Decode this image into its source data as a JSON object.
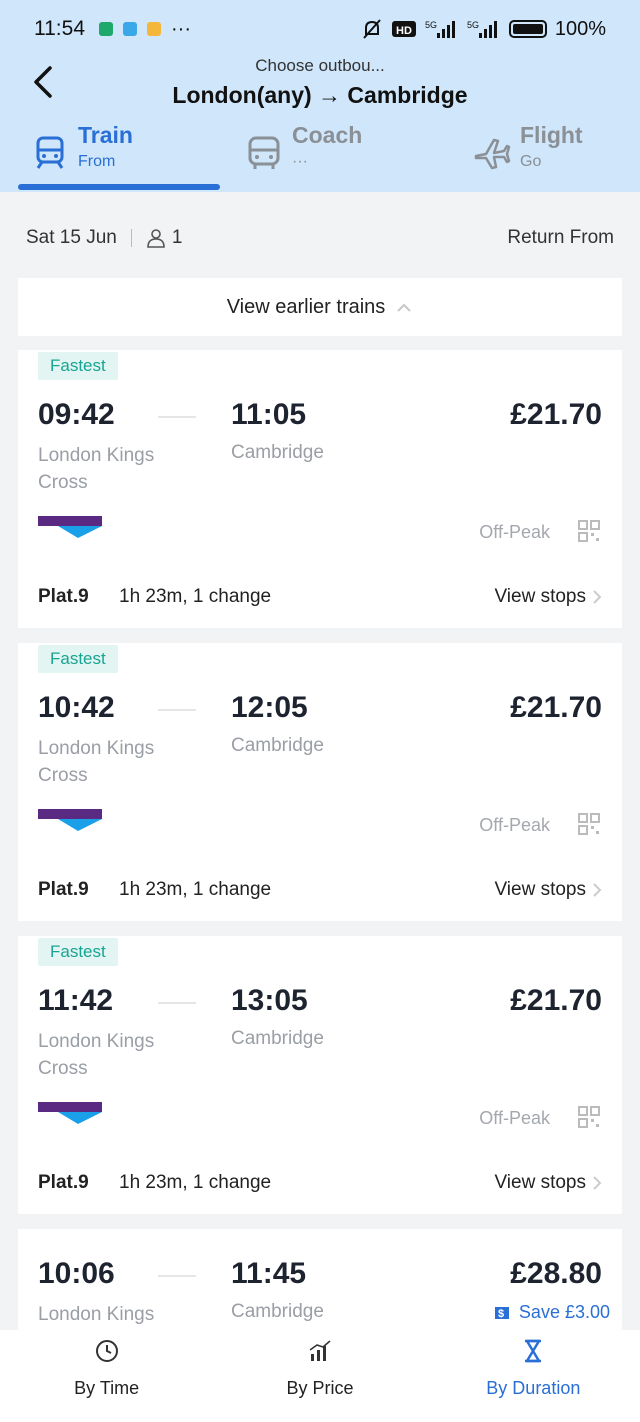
{
  "status": {
    "time": "11:54",
    "battery": "100%",
    "dots": "···"
  },
  "header": {
    "subtitle": "Choose outbou...",
    "route": "London(any) → Cambridge"
  },
  "tabs": [
    {
      "label": "Train",
      "sub": "From",
      "active": true
    },
    {
      "label": "Coach",
      "sub": "···"
    },
    {
      "label": "Flight",
      "sub": "Go"
    }
  ],
  "datebar": {
    "date": "Sat 15 Jun",
    "passengers": "1",
    "return_label": "Return From"
  },
  "earlier": {
    "label": "View earlier trains"
  },
  "journeys": [
    {
      "badge": "Fastest",
      "dep": "09:42",
      "arr": "11:05",
      "price": "£21.70",
      "from": "London Kings Cross",
      "to": "Cambridge",
      "fare": "Off-Peak",
      "plat": "Plat.9",
      "duration": "1h 23m, 1 change",
      "stops": "View stops"
    },
    {
      "badge": "Fastest",
      "dep": "10:42",
      "arr": "12:05",
      "price": "£21.70",
      "from": "London Kings Cross",
      "to": "Cambridge",
      "fare": "Off-Peak",
      "plat": "Plat.9",
      "duration": "1h 23m, 1 change",
      "stops": "View stops"
    },
    {
      "badge": "Fastest",
      "dep": "11:42",
      "arr": "13:05",
      "price": "£21.70",
      "from": "London Kings Cross",
      "to": "Cambridge",
      "fare": "Off-Peak",
      "plat": "Plat.9",
      "duration": "1h 23m, 1 change",
      "stops": "View stops"
    },
    {
      "dep": "10:06",
      "arr": "11:45",
      "price": "£28.80",
      "from": "London Kings",
      "to": "Cambridge",
      "save": "Save £3.00"
    }
  ],
  "bottom_nav": [
    {
      "label": "By Time",
      "icon": "clock-icon"
    },
    {
      "label": "By Price",
      "icon": "price-chart-icon"
    },
    {
      "label": "By Duration",
      "icon": "hourglass-icon",
      "active": true
    }
  ],
  "colors": {
    "accent": "#2a6fd6",
    "header_bg": "#cfe6fb",
    "badge_text": "#18a493",
    "badge_bg": "#e2f5f2"
  }
}
